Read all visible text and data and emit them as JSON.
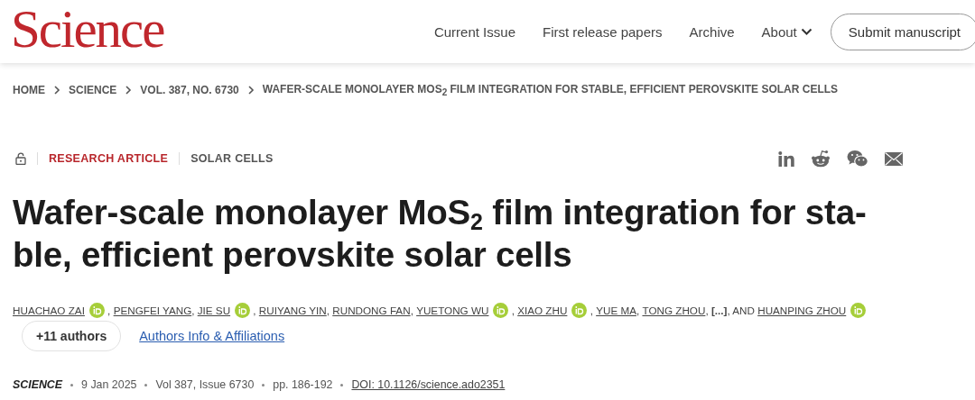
{
  "header": {
    "logo": "Science",
    "nav": [
      {
        "label": "Current Issue",
        "kind": "link"
      },
      {
        "label": "First release papers",
        "kind": "link"
      },
      {
        "label": "Archive",
        "kind": "link"
      },
      {
        "label": "About",
        "kind": "dropdown"
      }
    ],
    "submit": "Submit manuscript"
  },
  "breadcrumb": [
    "HOME",
    "SCIENCE",
    "VOL. 387, NO. 6730",
    "WAFER-SCALE MONOLAYER MOS$_{2}$ FILM INTEGRATION FOR STABLE, EFFICIENT PEROVSKITE SOLAR CELLS"
  ],
  "article": {
    "type": "RESEARCH ARTICLE",
    "topic": "SOLAR CELLS",
    "title_lines": [
      "Wafer-scale monolayer MoS$_{2}$ film integration for sta-",
      "ble, efficient perovskite solar cells"
    ],
    "authors": [
      {
        "kind": "author",
        "name": "HUACHAO ZAI",
        "orcid": true,
        "after": ","
      },
      {
        "kind": "author",
        "name": "PENGFEI YANG",
        "orcid": false,
        "after": ","
      },
      {
        "kind": "author",
        "name": "JIE SU",
        "orcid": true,
        "after": ","
      },
      {
        "kind": "author",
        "name": "RUIYANG YIN",
        "orcid": false,
        "after": ","
      },
      {
        "kind": "author",
        "name": "RUNDONG FAN",
        "orcid": false,
        "after": ","
      },
      {
        "kind": "author",
        "name": "YUETONG WU",
        "orcid": true,
        "after": ","
      },
      {
        "kind": "author",
        "name": "XIAO ZHU",
        "orcid": true,
        "after": ","
      },
      {
        "kind": "author",
        "name": "YUE MA",
        "orcid": false,
        "after": ","
      },
      {
        "kind": "author",
        "name": "TONG ZHOU",
        "orcid": false,
        "after": ","
      },
      {
        "kind": "ellipsis",
        "name": "[...]",
        "orcid": false,
        "after": ", AND"
      },
      {
        "kind": "author",
        "name": "HUANPING ZHOU",
        "orcid": true
      }
    ],
    "more_authors": "+11 authors",
    "affiliations": "Authors Info & Affiliations",
    "meta": {
      "journal": "SCIENCE",
      "date": "9 Jan 2025",
      "volume": "Vol 387, Issue 6730",
      "pages": "pp. 186-192",
      "doi": "DOI: 10.1126/science.ado2351"
    }
  }
}
